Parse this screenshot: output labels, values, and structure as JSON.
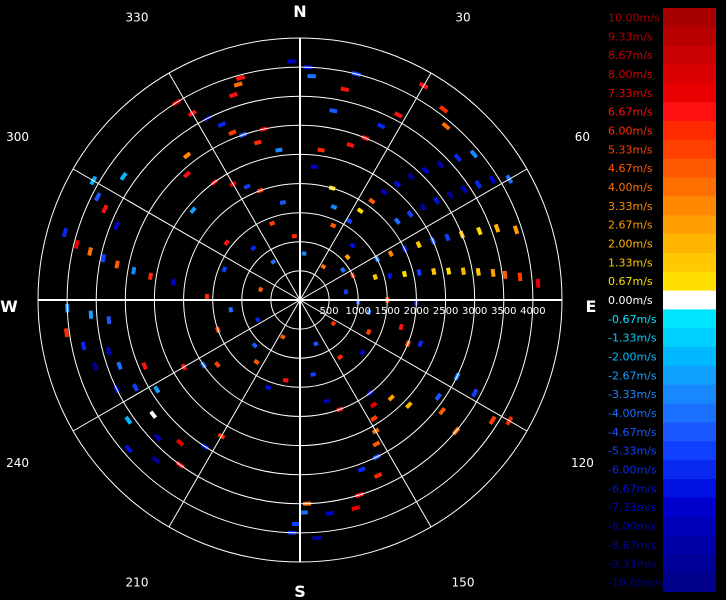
{
  "chart_data": {
    "type": "polar-heatmap",
    "cardinals": {
      "N": "N",
      "E": "E",
      "S": "S",
      "W": "W"
    },
    "bearing_labels": [
      {
        "deg": 30,
        "text": "30"
      },
      {
        "deg": 60,
        "text": "60"
      },
      {
        "deg": 120,
        "text": "120"
      },
      {
        "deg": 150,
        "text": "150"
      },
      {
        "deg": 210,
        "text": "210"
      },
      {
        "deg": 240,
        "text": "240"
      },
      {
        "deg": 300,
        "text": "300"
      },
      {
        "deg": 330,
        "text": "330"
      }
    ],
    "range_labels": [
      "500",
      "1000",
      "1500",
      "2000",
      "2500",
      "3000",
      "3500",
      "4000"
    ],
    "range_max": 4500,
    "ring_values": [
      500,
      1000,
      1500,
      2000,
      2500,
      3000,
      3500,
      4000,
      4500
    ],
    "grid": true,
    "velocity_scale": {
      "labels": [
        "10.00m/s",
        "9.33m/s",
        "8.67m/s",
        "8.00m/s",
        "7.33m/s",
        "6.67m/s",
        "6.00m/s",
        "5.33m/s",
        "4.67m/s",
        "4.00m/s",
        "3.33m/s",
        "2.67m/s",
        "2.00m/s",
        "1.33m/s",
        "0.67m/s",
        "0.00m/s",
        "-0.67m/s",
        "-1.33m/s",
        "-2.00m/s",
        "-2.67m/s",
        "-3.33m/s",
        "-4.00m/s",
        "-4.67m/s",
        "-5.33m/s",
        "-6.00m/s",
        "-6.67m/s",
        "-7.33m/s",
        "-8.00m/s",
        "-8.67m/s",
        "-9.33m/s",
        "-10.00m/s"
      ],
      "colors": [
        "#a80000",
        "#b80000",
        "#c80000",
        "#d80000",
        "#e80000",
        "#ff1010",
        "#ff2a00",
        "#ff4000",
        "#ff5a00",
        "#ff7000",
        "#ff8800",
        "#ff9e00",
        "#ffb400",
        "#ffc800",
        "#ffde00",
        "#ffffff",
        "#00e5ff",
        "#00d0ff",
        "#00b8ff",
        "#10a0ff",
        "#1888ff",
        "#1a70ff",
        "#1a58ff",
        "#1040ff",
        "#0828f0",
        "#0010e0",
        "#0000cc",
        "#0000b8",
        "#0000a8",
        "#000098",
        "#000088"
      ]
    },
    "cells": [
      {
        "az": 358,
        "r": 4100,
        "v": -7.2
      },
      {
        "az": 2,
        "r": 4000,
        "v": -6.5
      },
      {
        "az": 3,
        "r": 3850,
        "v": -4.2
      },
      {
        "az": 345,
        "r": 3950,
        "v": 6.4
      },
      {
        "az": 344,
        "r": 3850,
        "v": 4.1
      },
      {
        "az": 342,
        "r": 3700,
        "v": 6.8
      },
      {
        "az": 328,
        "r": 4000,
        "v": 7.4
      },
      {
        "az": 330,
        "r": 3700,
        "v": 6.9
      },
      {
        "az": 333,
        "r": 3500,
        "v": -8.4
      },
      {
        "az": 336,
        "r": 3300,
        "v": -6.0
      },
      {
        "az": 338,
        "r": 3100,
        "v": 5.4
      },
      {
        "az": 341,
        "r": 3000,
        "v": -4.8
      },
      {
        "az": 345,
        "r": 2800,
        "v": 6.2
      },
      {
        "az": 348,
        "r": 3000,
        "v": 7.8
      },
      {
        "az": 352,
        "r": 2600,
        "v": -3.0
      },
      {
        "az": 322,
        "r": 3150,
        "v": 3.1
      },
      {
        "az": 318,
        "r": 2900,
        "v": 6.6
      },
      {
        "az": 324,
        "r": 2500,
        "v": 7.1
      },
      {
        "az": 330,
        "r": 2300,
        "v": 8.2
      },
      {
        "az": 335,
        "r": 2150,
        "v": -5.2
      },
      {
        "az": 340,
        "r": 2000,
        "v": 6.0
      },
      {
        "az": 310,
        "r": 2400,
        "v": -2.8
      },
      {
        "az": 305,
        "r": 3700,
        "v": -2.3
      },
      {
        "az": 300,
        "r": 4100,
        "v": -2.0
      },
      {
        "az": 297,
        "r": 3900,
        "v": -4.5
      },
      {
        "az": 295,
        "r": 3700,
        "v": 6.8
      },
      {
        "az": 292,
        "r": 3400,
        "v": -7.3
      },
      {
        "az": 286,
        "r": 4200,
        "v": -6.1
      },
      {
        "az": 284,
        "r": 3950,
        "v": 7.2
      },
      {
        "az": 283,
        "r": 3700,
        "v": 4.2
      },
      {
        "az": 282,
        "r": 3450,
        "v": -5.6
      },
      {
        "az": 281,
        "r": 3200,
        "v": 5.0
      },
      {
        "az": 280,
        "r": 2900,
        "v": -3.5
      },
      {
        "az": 279,
        "r": 2600,
        "v": 6.1
      },
      {
        "az": 278,
        "r": 2200,
        "v": -7.4
      },
      {
        "az": 268,
        "r": 4000,
        "v": -3.2
      },
      {
        "az": 266,
        "r": 3600,
        "v": -2.6
      },
      {
        "az": 264,
        "r": 3300,
        "v": -4.6
      },
      {
        "az": 262,
        "r": 4050,
        "v": 6.0
      },
      {
        "az": 258,
        "r": 3800,
        "v": -6.2
      },
      {
        "az": 255,
        "r": 3400,
        "v": -8.2
      },
      {
        "az": 252,
        "r": 3700,
        "v": -9.0
      },
      {
        "az": 250,
        "r": 3300,
        "v": -3.9
      },
      {
        "az": 247,
        "r": 2900,
        "v": 7.0
      },
      {
        "az": 244,
        "r": 3500,
        "v": -6.6
      },
      {
        "az": 242,
        "r": 3200,
        "v": -5.4
      },
      {
        "az": 238,
        "r": 2900,
        "v": -2.4
      },
      {
        "az": 235,
        "r": 3600,
        "v": -1.8
      },
      {
        "az": 232,
        "r": 3200,
        "v": 0.0
      },
      {
        "az": 229,
        "r": 3900,
        "v": -6.8
      },
      {
        "az": 226,
        "r": 3400,
        "v": -7.9
      },
      {
        "az": 222,
        "r": 3700,
        "v": -8.8
      },
      {
        "az": 220,
        "r": 3200,
        "v": 7.3
      },
      {
        "az": 216,
        "r": 3500,
        "v": 6.7
      },
      {
        "az": 213,
        "r": 3000,
        "v": -5.7
      },
      {
        "az": 210,
        "r": 2700,
        "v": 6.2
      },
      {
        "az": 240,
        "r": 2300,
        "v": 6.9
      },
      {
        "az": 236,
        "r": 2000,
        "v": -4.3
      },
      {
        "az": 232,
        "r": 1800,
        "v": 5.5
      },
      {
        "az": 182,
        "r": 4000,
        "v": -6.2
      },
      {
        "az": 181,
        "r": 3850,
        "v": -5.1
      },
      {
        "az": 179,
        "r": 3650,
        "v": -4.0
      },
      {
        "az": 178,
        "r": 3500,
        "v": 4.3
      },
      {
        "az": 176,
        "r": 4100,
        "v": -9.0
      },
      {
        "az": 172,
        "r": 3700,
        "v": -7.6
      },
      {
        "az": 165,
        "r": 3700,
        "v": 7.4
      },
      {
        "az": 163,
        "r": 3500,
        "v": 6.5
      },
      {
        "az": 160,
        "r": 3100,
        "v": -5.8
      },
      {
        "az": 156,
        "r": 3300,
        "v": 6.0
      },
      {
        "az": 154,
        "r": 3000,
        "v": -4.4
      },
      {
        "az": 152,
        "r": 2800,
        "v": 4.6
      },
      {
        "az": 150,
        "r": 2600,
        "v": 3.9
      },
      {
        "az": 148,
        "r": 2400,
        "v": 5.1
      },
      {
        "az": 145,
        "r": 2200,
        "v": 7.2
      },
      {
        "az": 143,
        "r": 2000,
        "v": -6.6
      },
      {
        "az": 160,
        "r": 2000,
        "v": 6.9
      },
      {
        "az": 165,
        "r": 1800,
        "v": -7.8
      },
      {
        "az": 130,
        "r": 3500,
        "v": 4.0
      },
      {
        "az": 128,
        "r": 3100,
        "v": 4.7
      },
      {
        "az": 125,
        "r": 2900,
        "v": -4.9
      },
      {
        "az": 122,
        "r": 3900,
        "v": 5.2
      },
      {
        "az": 120,
        "r": 4150,
        "v": 6.3
      },
      {
        "az": 118,
        "r": 3400,
        "v": -5.3
      },
      {
        "az": 116,
        "r": 3000,
        "v": -3.6
      },
      {
        "az": 134,
        "r": 2600,
        "v": 1.8
      },
      {
        "az": 137,
        "r": 2300,
        "v": 3.0
      },
      {
        "az": 112,
        "r": 2000,
        "v": 4.4
      },
      {
        "az": 110,
        "r": 2200,
        "v": -6.0
      },
      {
        "az": 105,
        "r": 1800,
        "v": 7.0
      },
      {
        "az": 92,
        "r": 1000,
        "v": -4.8
      },
      {
        "az": 90,
        "r": 1500,
        "v": 5.0
      },
      {
        "az": 91,
        "r": 2000,
        "v": -5.8
      },
      {
        "az": 86,
        "r": 4100,
        "v": 7.6
      },
      {
        "az": 84,
        "r": 3800,
        "v": 5.6
      },
      {
        "az": 83,
        "r": 3550,
        "v": 5.0
      },
      {
        "az": 82,
        "r": 3350,
        "v": 2.7
      },
      {
        "az": 81,
        "r": 3100,
        "v": 1.6
      },
      {
        "az": 80,
        "r": 2850,
        "v": 2.2
      },
      {
        "az": 79,
        "r": 2600,
        "v": 0.9
      },
      {
        "az": 78,
        "r": 2350,
        "v": 1.4
      },
      {
        "az": 77,
        "r": 2100,
        "v": -5.0
      },
      {
        "az": 76,
        "r": 1850,
        "v": 0.7
      },
      {
        "az": 75,
        "r": 1600,
        "v": -6.5
      },
      {
        "az": 73,
        "r": 1350,
        "v": 1.2
      },
      {
        "az": 72,
        "r": 3900,
        "v": 3.0
      },
      {
        "az": 70,
        "r": 3600,
        "v": 1.7
      },
      {
        "az": 69,
        "r": 3300,
        "v": 0.9
      },
      {
        "az": 68,
        "r": 3000,
        "v": 2.0
      },
      {
        "az": 67,
        "r": 2750,
        "v": -5.4
      },
      {
        "az": 66,
        "r": 2500,
        "v": -4.7
      },
      {
        "az": 65,
        "r": 2250,
        "v": 1.1
      },
      {
        "az": 64,
        "r": 2000,
        "v": -6.3
      },
      {
        "az": 63,
        "r": 1750,
        "v": 3.2
      },
      {
        "az": 62,
        "r": 1500,
        "v": -3.3
      },
      {
        "az": 60,
        "r": 4150,
        "v": -4.2
      },
      {
        "az": 58,
        "r": 3900,
        "v": -7.5
      },
      {
        "az": 57,
        "r": 3650,
        "v": -5.7
      },
      {
        "az": 56,
        "r": 3400,
        "v": -8.0
      },
      {
        "az": 55,
        "r": 3150,
        "v": -9.3
      },
      {
        "az": 54,
        "r": 2900,
        "v": -6.9
      },
      {
        "az": 53,
        "r": 2650,
        "v": -8.6
      },
      {
        "az": 52,
        "r": 2400,
        "v": -5.1
      },
      {
        "az": 51,
        "r": 2150,
        "v": -4.0
      },
      {
        "az": 50,
        "r": 3900,
        "v": -3.5
      },
      {
        "az": 48,
        "r": 3650,
        "v": -6.1
      },
      {
        "az": 46,
        "r": 3350,
        "v": -8.8
      },
      {
        "az": 44,
        "r": 3100,
        "v": -7.0
      },
      {
        "az": 42,
        "r": 2850,
        "v": -9.4
      },
      {
        "az": 40,
        "r": 2600,
        "v": -6.6
      },
      {
        "az": 38,
        "r": 2350,
        "v": -7.7
      },
      {
        "az": 36,
        "r": 2100,
        "v": 4.5
      },
      {
        "az": 34,
        "r": 1850,
        "v": 1.0
      },
      {
        "az": 32,
        "r": 1600,
        "v": -5.2
      },
      {
        "az": 30,
        "r": 4250,
        "v": 6.4
      },
      {
        "az": 37,
        "r": 4100,
        "v": 5.9
      },
      {
        "az": 40,
        "r": 3900,
        "v": 3.8
      },
      {
        "az": 28,
        "r": 3600,
        "v": 6.8
      },
      {
        "az": 25,
        "r": 3300,
        "v": -6.0
      },
      {
        "az": 22,
        "r": 3000,
        "v": 7.0
      },
      {
        "az": 18,
        "r": 2800,
        "v": 6.6
      },
      {
        "az": 14,
        "r": 4000,
        "v": -5.5
      },
      {
        "az": 12,
        "r": 3700,
        "v": 6.9
      },
      {
        "az": 10,
        "r": 3300,
        "v": -4.8
      },
      {
        "az": 8,
        "r": 2600,
        "v": 5.8
      },
      {
        "az": 6,
        "r": 2300,
        "v": -7.1
      },
      {
        "az": 16,
        "r": 2000,
        "v": 1.0
      },
      {
        "az": 20,
        "r": 1700,
        "v": -3.0
      },
      {
        "az": 24,
        "r": 1400,
        "v": 4.4
      },
      {
        "az": 44,
        "r": 1300,
        "v": -6.4
      },
      {
        "az": 48,
        "r": 1100,
        "v": 2.5
      },
      {
        "az": 55,
        "r": 900,
        "v": -4.2
      },
      {
        "az": 65,
        "r": 1000,
        "v": 6.0
      },
      {
        "az": 100,
        "r": 1200,
        "v": -4.0
      },
      {
        "az": 115,
        "r": 1300,
        "v": 5.6
      },
      {
        "az": 130,
        "r": 1400,
        "v": -7.0
      },
      {
        "az": 145,
        "r": 1200,
        "v": 6.3
      },
      {
        "az": 170,
        "r": 1300,
        "v": -5.5
      },
      {
        "az": 190,
        "r": 1400,
        "v": 6.6
      },
      {
        "az": 200,
        "r": 1600,
        "v": -6.9
      },
      {
        "az": 215,
        "r": 1300,
        "v": 4.9
      },
      {
        "az": 225,
        "r": 1100,
        "v": -4.4
      },
      {
        "az": 250,
        "r": 1500,
        "v": 5.3
      },
      {
        "az": 262,
        "r": 1200,
        "v": -3.8
      },
      {
        "az": 272,
        "r": 1600,
        "v": 6.1
      },
      {
        "az": 292,
        "r": 1400,
        "v": -5.0
      },
      {
        "az": 308,
        "r": 1600,
        "v": 6.8
      },
      {
        "az": 318,
        "r": 1200,
        "v": -6.1
      },
      {
        "az": 340,
        "r": 1400,
        "v": 5.4
      },
      {
        "az": 350,
        "r": 1700,
        "v": -4.6
      },
      {
        "az": 355,
        "r": 1100,
        "v": 6.2
      },
      {
        "az": 5,
        "r": 800,
        "v": -3.1
      },
      {
        "az": 35,
        "r": 700,
        "v": 4.2
      },
      {
        "az": 80,
        "r": 800,
        "v": -5.1
      },
      {
        "az": 125,
        "r": 700,
        "v": 6.1
      },
      {
        "az": 160,
        "r": 800,
        "v": -4.4
      },
      {
        "az": 205,
        "r": 700,
        "v": 5.0
      },
      {
        "az": 245,
        "r": 800,
        "v": -6.0
      },
      {
        "az": 285,
        "r": 700,
        "v": 4.6
      },
      {
        "az": 325,
        "r": 800,
        "v": -3.7
      }
    ]
  }
}
